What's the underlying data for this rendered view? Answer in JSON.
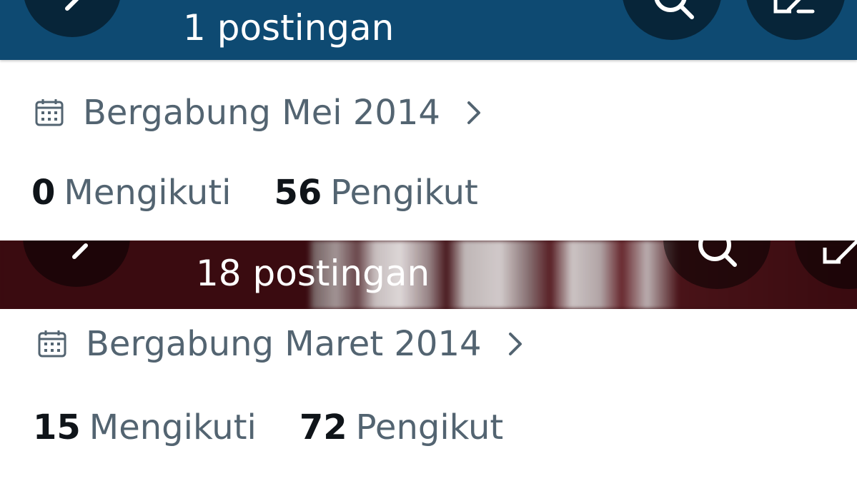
{
  "profiles": [
    {
      "post_count_text": "1 postingan",
      "joined_text": "Bergabung Mei 2014",
      "following_count": "0",
      "following_label": "Mengikuti",
      "followers_count": "56",
      "followers_label": "Pengikut",
      "header_color": "#0e4a72"
    },
    {
      "post_count_text": "18 postingan",
      "joined_text": "Bergabung Maret 2014",
      "following_count": "15",
      "following_label": "Mengikuti",
      "followers_count": "72",
      "followers_label": "Pengikut",
      "header_color": "#3a0b10"
    }
  ],
  "icons": {
    "back": "arrow-left-icon",
    "search": "search-icon",
    "compose": "compose-icon",
    "calendar": "calendar-icon",
    "chevron": "chevron-right-icon"
  },
  "colors": {
    "secondary_text": "#536471",
    "primary_text": "#0f1419"
  }
}
